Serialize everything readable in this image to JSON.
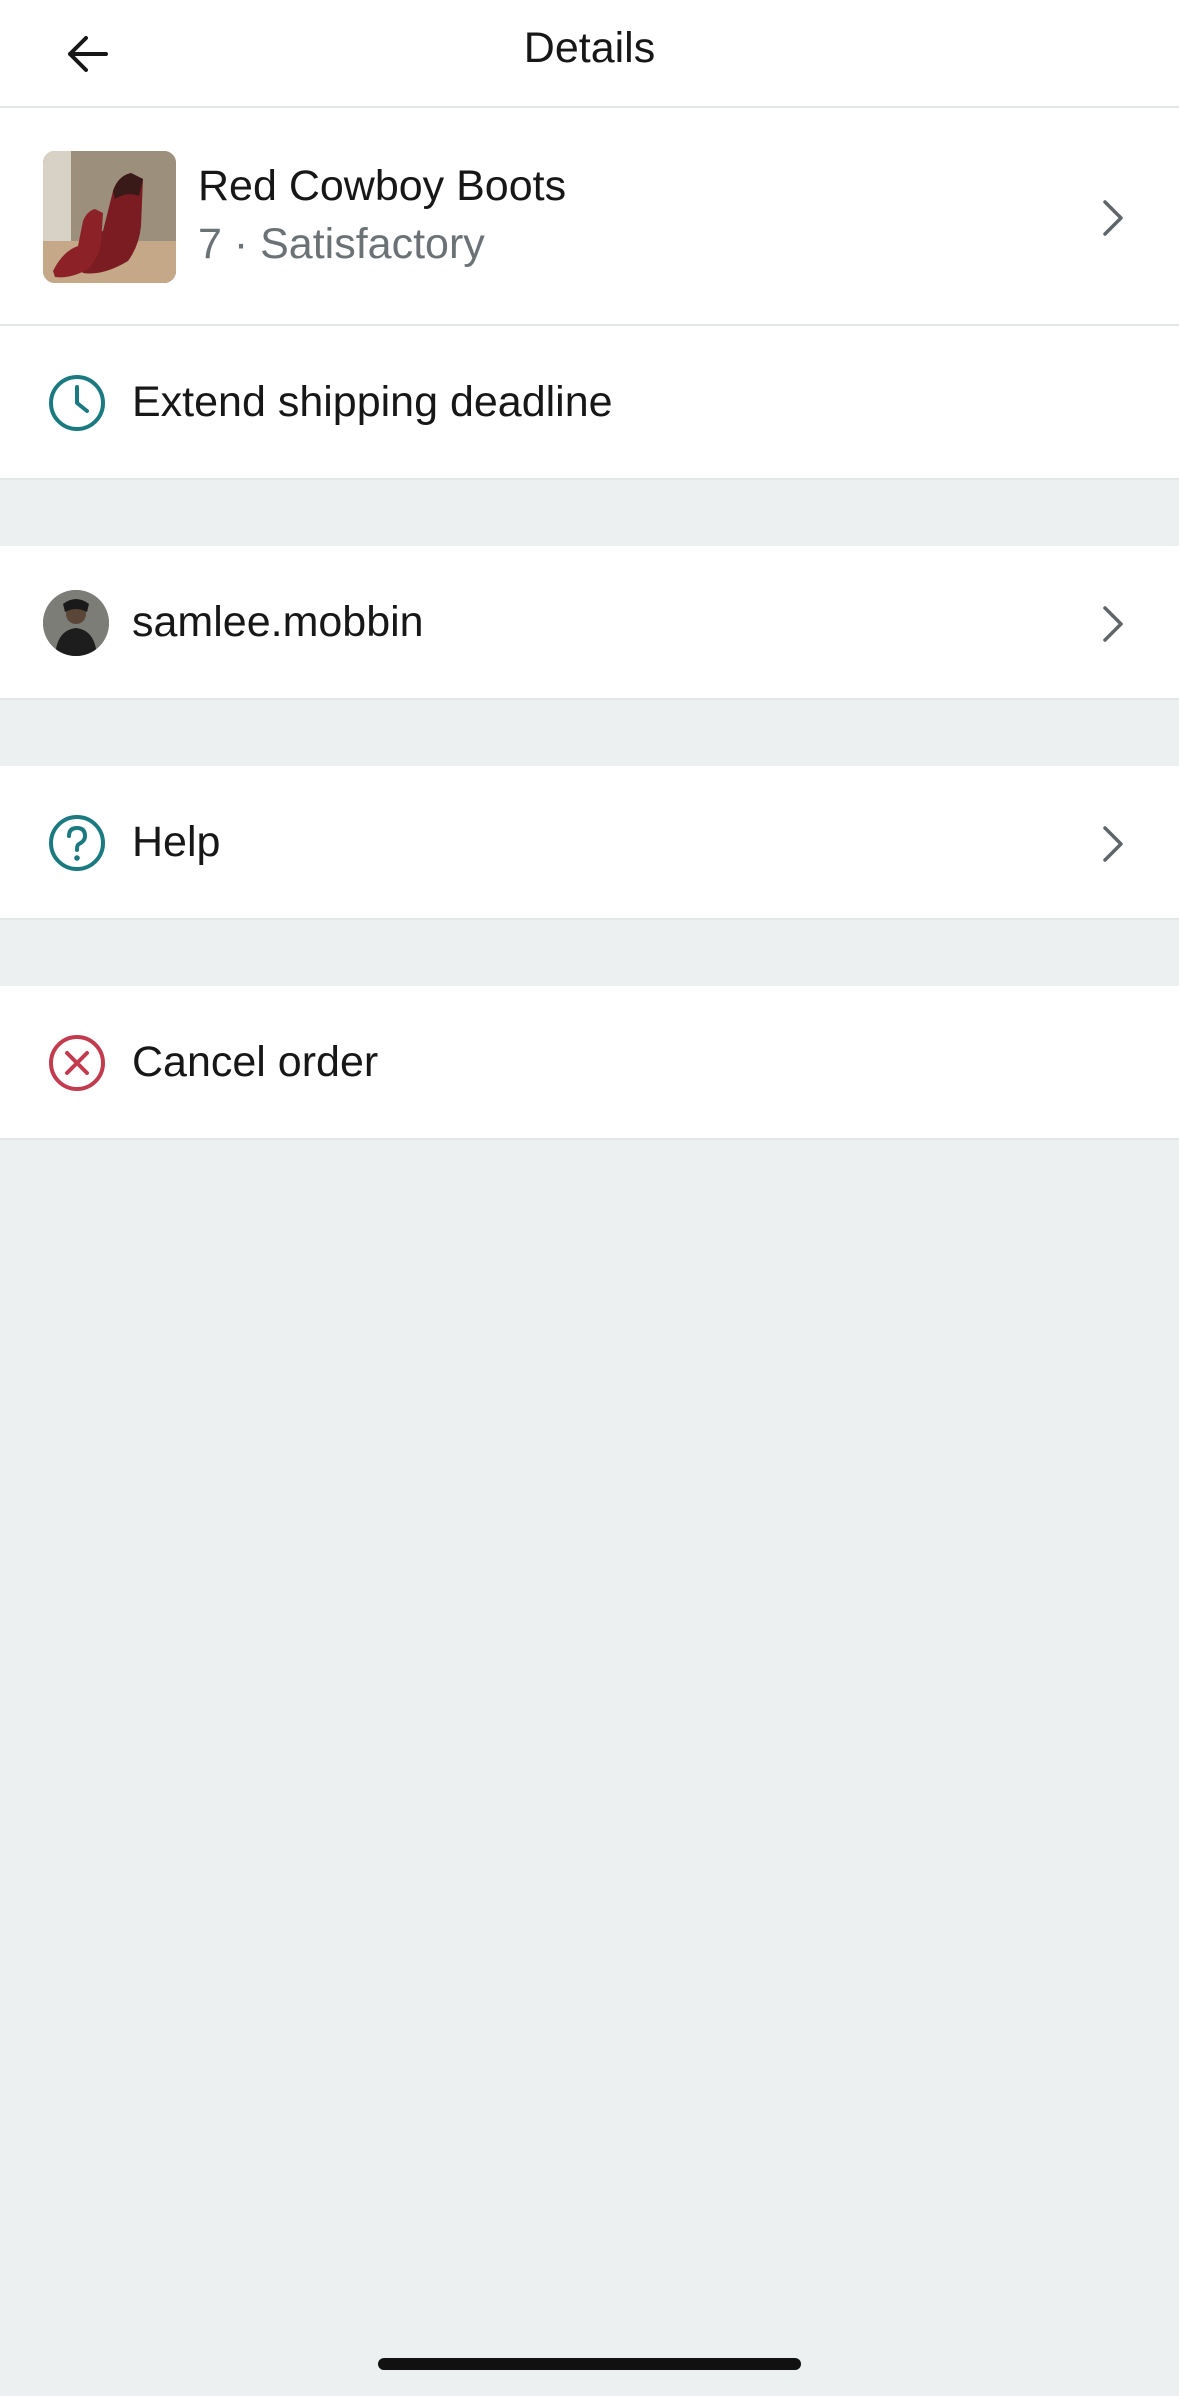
{
  "header": {
    "title": "Details",
    "back_icon": "arrow-left-icon"
  },
  "product": {
    "title": "Red Cowboy Boots",
    "subtitle": "7 · Satisfactory",
    "image_icon": "product-thumbnail"
  },
  "actions": {
    "extend_label": "Extend shipping deadline",
    "extend_icon": "clock-icon",
    "user_label": "samlee.mobbin",
    "help_label": "Help",
    "help_icon": "question-circle-icon",
    "cancel_label": "Cancel order",
    "cancel_icon": "x-circle-icon"
  },
  "colors": {
    "accent_teal": "#1a7a80",
    "danger_red": "#c23b4e",
    "background": "#edf0f1",
    "surface": "#ffffff"
  }
}
